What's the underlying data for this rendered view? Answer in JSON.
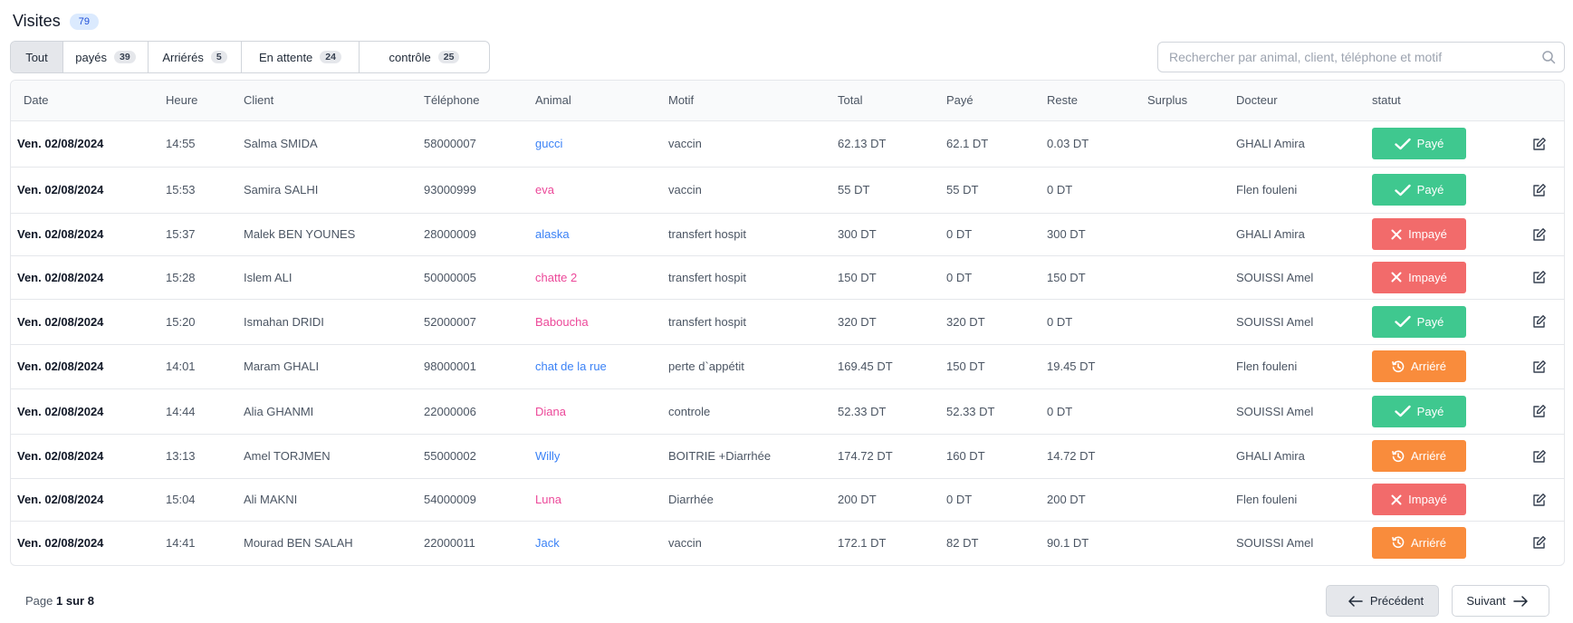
{
  "header": {
    "title": "Visites",
    "count": "79"
  },
  "tabs": [
    {
      "label": "Tout",
      "count": ""
    },
    {
      "label": "payés",
      "count": "39"
    },
    {
      "label": "Arriérés",
      "count": "5"
    },
    {
      "label": "En attente",
      "count": "24"
    },
    {
      "label": "contrôle",
      "count": "25"
    }
  ],
  "search": {
    "placeholder": "Rechercher par animal, client, téléphone et motif",
    "value": ""
  },
  "columns": [
    "Date",
    "Heure",
    "Client",
    "Téléphone",
    "Animal",
    "Motif",
    "Total",
    "Payé",
    "Reste",
    "Surplus",
    "Docteur",
    "statut"
  ],
  "rows": [
    {
      "date": "Ven. 02/08/2024",
      "heure": "14:55",
      "client": "Salma SMIDA",
      "tel": "58000007",
      "animal": "gucci",
      "animal_color": "blue",
      "motif": "vaccin",
      "total": "62.13 DT",
      "paye": "62.1 DT",
      "reste": "0.03 DT",
      "surplus": "",
      "docteur": "GHALI Amira",
      "statut": "Payé",
      "statut_type": "paid"
    },
    {
      "date": "Ven. 02/08/2024",
      "heure": "15:53",
      "client": "Samira SALHI",
      "tel": "93000999",
      "animal": "eva",
      "animal_color": "pink",
      "motif": "vaccin",
      "total": "55 DT",
      "paye": "55 DT",
      "reste": "0 DT",
      "surplus": "",
      "docteur": "Flen fouleni",
      "statut": "Payé",
      "statut_type": "paid"
    },
    {
      "date": "Ven. 02/08/2024",
      "heure": "15:37",
      "client": "Malek BEN YOUNES",
      "tel": "28000009",
      "animal": "alaska",
      "animal_color": "blue",
      "motif": "transfert hospit",
      "total": "300 DT",
      "paye": "0 DT",
      "reste": "300 DT",
      "surplus": "",
      "docteur": "GHALI Amira",
      "statut": "Impayé",
      "statut_type": "unpaid"
    },
    {
      "date": "Ven. 02/08/2024",
      "heure": "15:28",
      "client": "Islem ALI",
      "tel": "50000005",
      "animal": "chatte 2",
      "animal_color": "pink",
      "motif": "transfert hospit",
      "total": "150 DT",
      "paye": "0 DT",
      "reste": "150 DT",
      "surplus": "",
      "docteur": "SOUISSI Amel",
      "statut": "Impayé",
      "statut_type": "unpaid"
    },
    {
      "date": "Ven. 02/08/2024",
      "heure": "15:20",
      "client": "Ismahan DRIDI",
      "tel": "52000007",
      "animal": "Baboucha",
      "animal_color": "pink",
      "motif": "transfert hospit",
      "total": "320 DT",
      "paye": "320 DT",
      "reste": "0 DT",
      "surplus": "",
      "docteur": "SOUISSI Amel",
      "statut": "Payé",
      "statut_type": "paid"
    },
    {
      "date": "Ven. 02/08/2024",
      "heure": "14:01",
      "client": "Maram GHALI",
      "tel": "98000001",
      "animal": "chat de la rue",
      "animal_color": "blue",
      "motif": "perte d`appétit",
      "total": "169.45 DT",
      "paye": "150 DT",
      "reste": "19.45 DT",
      "surplus": "",
      "docteur": "Flen fouleni",
      "statut": "Arriéré",
      "statut_type": "late"
    },
    {
      "date": "Ven. 02/08/2024",
      "heure": "14:44",
      "client": "Alia GHANMI",
      "tel": "22000006",
      "animal": "Diana",
      "animal_color": "pink",
      "motif": "controle",
      "total": "52.33 DT",
      "paye": "52.33 DT",
      "reste": "0 DT",
      "surplus": "",
      "docteur": "SOUISSI Amel",
      "statut": "Payé",
      "statut_type": "paid"
    },
    {
      "date": "Ven. 02/08/2024",
      "heure": "13:13",
      "client": "Amel TORJMEN",
      "tel": "55000002",
      "animal": "Willy",
      "animal_color": "blue",
      "motif": "BOITRIE +Diarrhée",
      "total": "174.72 DT",
      "paye": "160 DT",
      "reste": "14.72 DT",
      "surplus": "",
      "docteur": "GHALI Amira",
      "statut": "Arriéré",
      "statut_type": "late"
    },
    {
      "date": "Ven. 02/08/2024",
      "heure": "15:04",
      "client": "Ali MAKNI",
      "tel": "54000009",
      "animal": "Luna",
      "animal_color": "pink",
      "motif": "Diarrhée",
      "total": "200 DT",
      "paye": "0 DT",
      "reste": "200 DT",
      "surplus": "",
      "docteur": "Flen fouleni",
      "statut": "Impayé",
      "statut_type": "unpaid"
    },
    {
      "date": "Ven. 02/08/2024",
      "heure": "14:41",
      "client": "Mourad BEN SALAH",
      "tel": "22000011",
      "animal": "Jack",
      "animal_color": "blue",
      "motif": "vaccin",
      "total": "172.1 DT",
      "paye": "82 DT",
      "reste": "90.1 DT",
      "surplus": "",
      "docteur": "SOUISSI Amel",
      "statut": "Arriéré",
      "statut_type": "late"
    }
  ],
  "pagination": {
    "prefix": "Page",
    "current": "1",
    "sep": "sur",
    "total": "8",
    "prev_label": "Précédent",
    "next_label": "Suivant"
  },
  "colors": {
    "paid": "#3fc88f",
    "unpaid": "#f26b6b",
    "late": "#f98c3c",
    "animal_blue": "#3b82f6",
    "animal_pink": "#ec4899"
  },
  "icons": {
    "search": "search-icon",
    "edit": "edit-icon",
    "paid": "check-icon",
    "unpaid": "x-icon",
    "late": "history-icon",
    "prev": "arrow-left-icon",
    "next": "arrow-right-icon"
  }
}
